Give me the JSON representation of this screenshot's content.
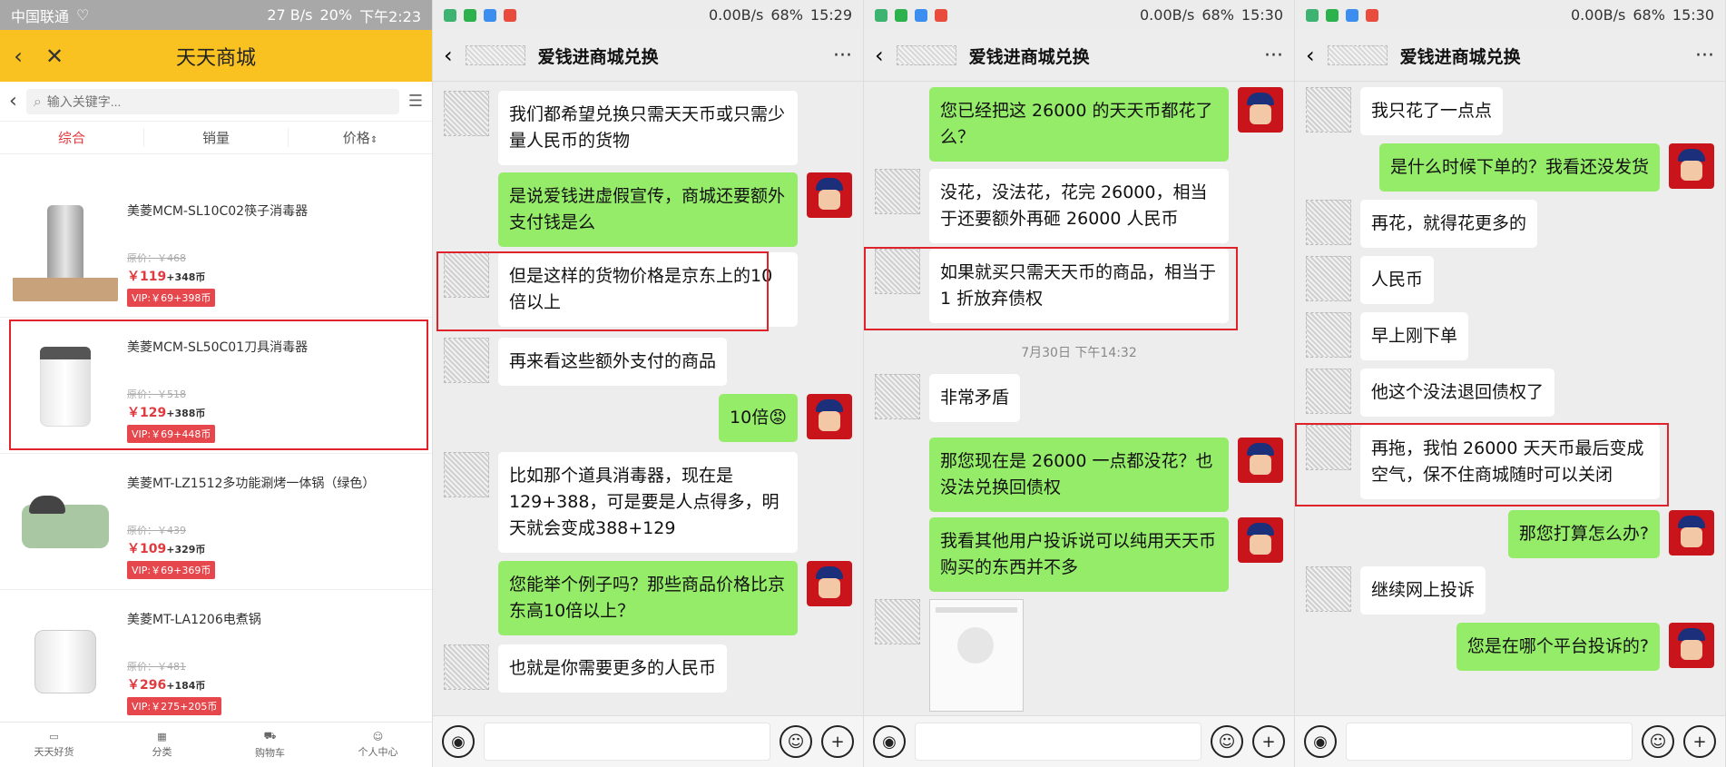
{
  "shop": {
    "status": {
      "carrier": "中国联通",
      "speed": "27 B/s",
      "battery": "20%",
      "time": "下午2:23"
    },
    "title": "天天商城",
    "search_placeholder": "输入关键字...",
    "sort": [
      "综合",
      "销量",
      "价格"
    ],
    "products": [
      {
        "name": "美菱MCM-SL10C02筷子消毒器",
        "orig": "原价：￥468",
        "price": "￥119",
        "coins": "+348币",
        "vip": "VIP:￥69+398币"
      },
      {
        "name": "美菱MCM-SL50C01刀具消毒器",
        "orig": "原价：￥518",
        "price": "￥129",
        "coins": "+388币",
        "vip": "VIP:￥69+448币"
      },
      {
        "name": "美菱MT-LZ1512多功能涮烤一体锅（绿色）",
        "orig": "原价：￥439",
        "price": "￥109",
        "coins": "+329币",
        "vip": "VIP:￥69+369币"
      },
      {
        "name": "美菱MT-LA1206电煮锅",
        "orig": "原价：￥481",
        "price": "￥296",
        "coins": "+184币",
        "vip": "VIP:￥275+205币"
      }
    ],
    "tabs": [
      "天天好货",
      "分类",
      "购物车",
      "个人中心"
    ]
  },
  "chat_title": "爱钱进商城兑换",
  "chats": [
    {
      "status": {
        "speed": "0.00B/s",
        "battery": "68%",
        "time": "15:29"
      },
      "messages": [
        {
          "side": "l",
          "text": "我们都希望兑换只需天天币或只需少量人民币的货物"
        },
        {
          "side": "r",
          "text": "是说爱钱进虚假宣传，商城还要额外支付钱是么"
        },
        {
          "side": "l",
          "text": "但是这样的货物价格是京东上的10倍以上"
        },
        {
          "side": "l",
          "text": "再来看这些额外支付的商品"
        },
        {
          "side": "r",
          "text": "10倍😡"
        },
        {
          "side": "l",
          "text": "比如那个道具消毒器，现在是129+388，可是要是人点得多，明天就会变成388+129"
        },
        {
          "side": "r",
          "text": "您能举个例子吗？那些商品价格比京东高10倍以上？"
        },
        {
          "side": "l",
          "text": "也就是你需要更多的人民币"
        }
      ]
    },
    {
      "status": {
        "speed": "0.00B/s",
        "battery": "68%",
        "time": "15:30"
      },
      "messages": [
        {
          "side": "r",
          "text": "您已经把这 26000 的天天币都花了么？"
        },
        {
          "side": "l",
          "text": "没花，没法花，花完 26000，相当于还要额外再砸 26000 人民币"
        },
        {
          "side": "l",
          "text": "如果就买只需天天币的商品，相当于 1 折放弃债权"
        },
        {
          "side": "ts",
          "text": "7月30日 下午14:32"
        },
        {
          "side": "l",
          "text": "非常矛盾"
        },
        {
          "side": "r",
          "text": "那您现在是 26000 一点都没花？也没法兑换回债权"
        },
        {
          "side": "r",
          "text": "我看其他用户投诉说可以纯用天天币购买的东西并不多"
        }
      ]
    },
    {
      "status": {
        "speed": "0.00B/s",
        "battery": "68%",
        "time": "15:30"
      },
      "messages": [
        {
          "side": "l",
          "text": "我只花了一点点"
        },
        {
          "side": "r",
          "text": "是什么时候下单的？我看还没发货"
        },
        {
          "side": "l",
          "text": "再花，就得花更多的"
        },
        {
          "side": "l",
          "text": "人民币"
        },
        {
          "side": "l",
          "text": "早上刚下单"
        },
        {
          "side": "l",
          "text": "他这个没法退回债权了"
        },
        {
          "side": "l",
          "text": "再拖，我怕 26000 天天币最后变成空气，保不住商城随时可以关闭"
        },
        {
          "side": "r",
          "text": "那您打算怎么办?"
        },
        {
          "side": "l",
          "text": "继续网上投诉"
        },
        {
          "side": "r",
          "text": "您是在哪个平台投诉的?"
        }
      ]
    }
  ]
}
